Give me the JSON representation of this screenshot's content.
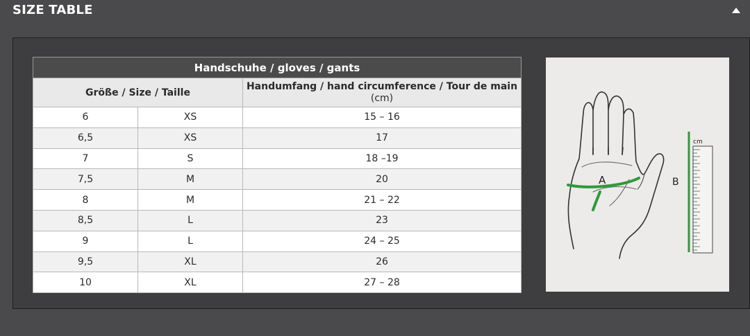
{
  "header": {
    "title": "SIZE TABLE",
    "toggle_icon": "triangle-up-icon"
  },
  "table": {
    "title": "Handschuhe / gloves / gants",
    "size_header": "Größe / Size / Taille",
    "circumference_header": "Handumfang / hand circumference / Tour de main",
    "circumference_unit": "(cm)",
    "rows": [
      {
        "eu": "6",
        "letter": "XS",
        "cm": "15 – 16"
      },
      {
        "eu": "6,5",
        "letter": "XS",
        "cm": "17"
      },
      {
        "eu": "7",
        "letter": "S",
        "cm": "18 –19"
      },
      {
        "eu": "7,5",
        "letter": "M",
        "cm": "20"
      },
      {
        "eu": "8",
        "letter": "M",
        "cm": "21 – 22"
      },
      {
        "eu": "8,5",
        "letter": "L",
        "cm": "23"
      },
      {
        "eu": "9",
        "letter": "L",
        "cm": "24 – 25"
      },
      {
        "eu": "9,5",
        "letter": "XL",
        "cm": "26"
      },
      {
        "eu": "10",
        "letter": "XL",
        "cm": "27 – 28"
      }
    ]
  },
  "illustration": {
    "label_a": "A",
    "label_b": "B",
    "ruler_unit": "cm",
    "measure_color": "#2e9a3a"
  }
}
